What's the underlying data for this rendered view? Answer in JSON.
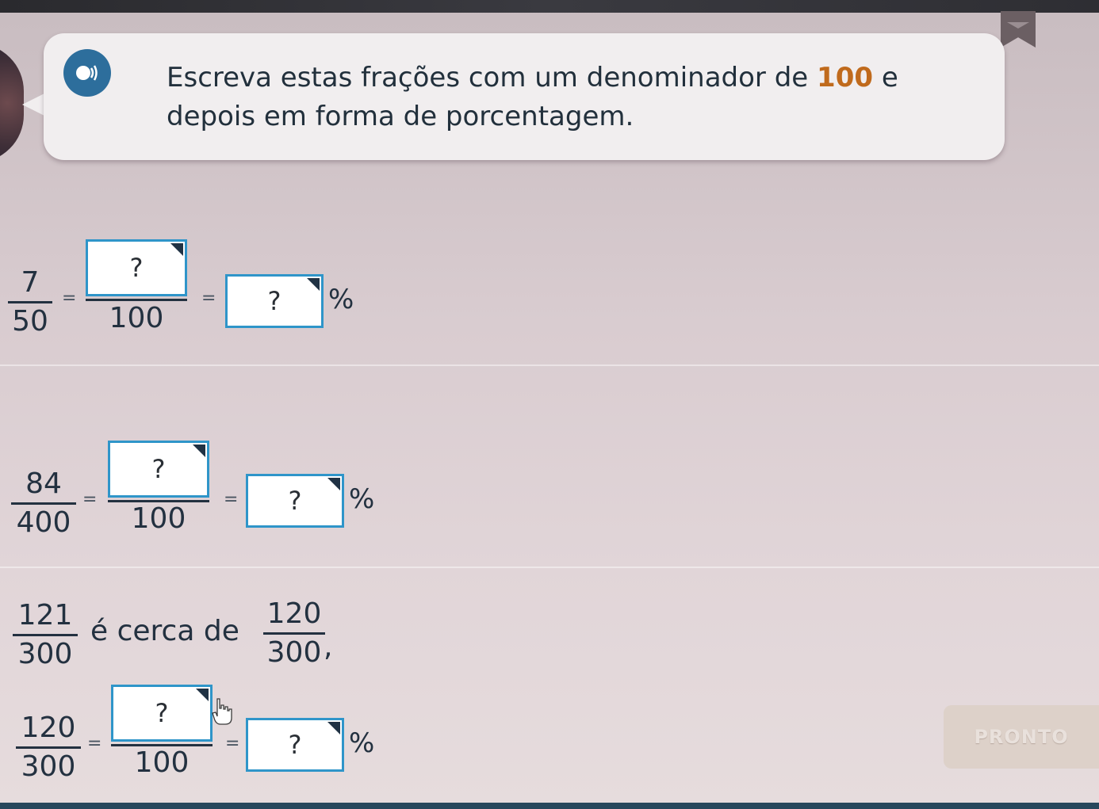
{
  "header": {
    "instruction_part1": "Escreva estas frações com um denominador de ",
    "instruction_highlight": "100",
    "instruction_part2": " e depois em forma de porcentagem.",
    "speaker_icon": "speaker-icon"
  },
  "problems": [
    {
      "numerator": "7",
      "denominator": "50",
      "equals": "=",
      "target_denominator": "100",
      "numerator_placeholder": "?",
      "percent_placeholder": "?",
      "percent_sign": "%"
    },
    {
      "numerator": "84",
      "denominator": "400",
      "equals": "=",
      "target_denominator": "100",
      "numerator_placeholder": "?",
      "percent_placeholder": "?",
      "percent_sign": "%"
    },
    {
      "approx_numerator": "121",
      "approx_denominator": "300",
      "approx_text": "é cerca de",
      "approx_round_numerator": "120",
      "approx_round_denominator": "300",
      "approx_punct": ",",
      "numerator": "120",
      "denominator": "300",
      "equals": "=",
      "target_denominator": "100",
      "numerator_placeholder": "?",
      "percent_placeholder": "?",
      "percent_sign": "%"
    }
  ],
  "done_button": {
    "label": "PRONTO"
  },
  "colors": {
    "accent": "#2f95c9",
    "highlight": "#c06a1c",
    "speaker": "#2d6e9c"
  }
}
